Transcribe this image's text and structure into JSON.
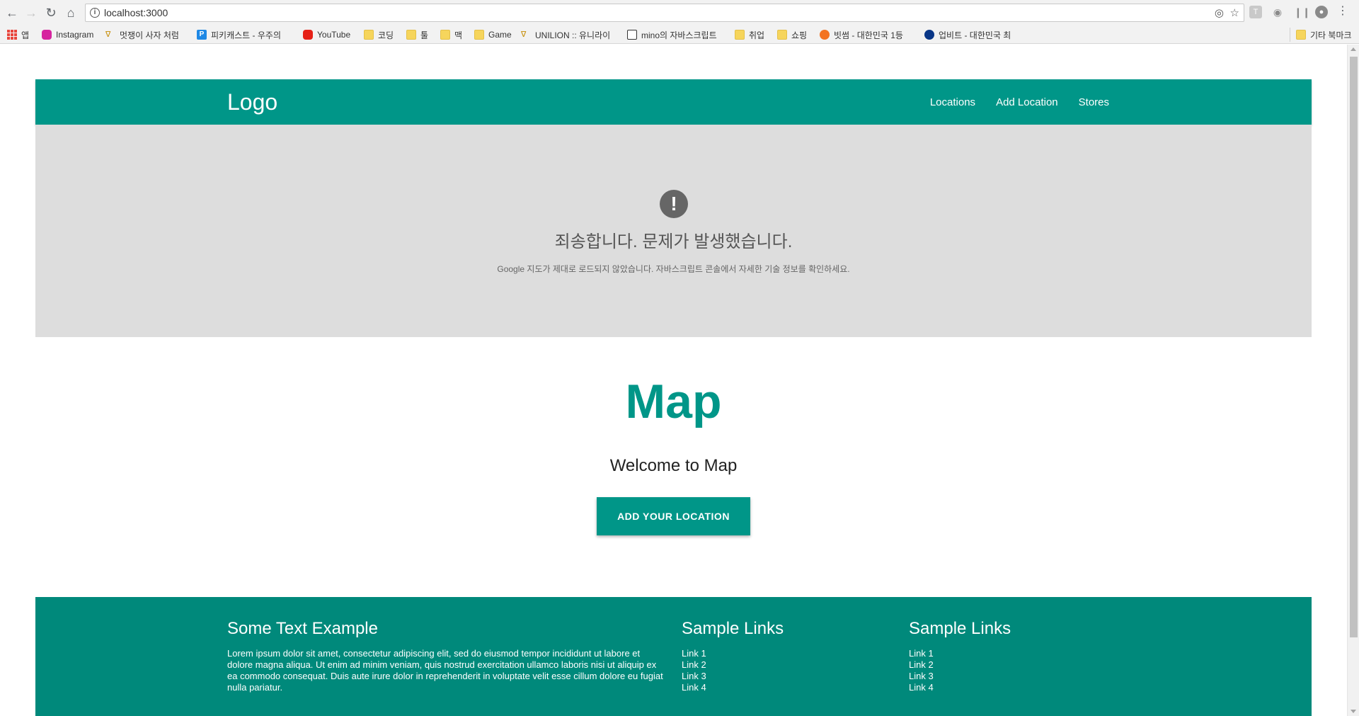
{
  "browser": {
    "url": "localhost:3000",
    "bookmarks": [
      {
        "label": "앱",
        "icon": "apps-grid-icon"
      },
      {
        "label": "Instagram",
        "icon": "instagram-icon"
      },
      {
        "label": "멋쟁이 사자 처럼",
        "icon": "lion-icon"
      },
      {
        "label": "피키캐스트 - 우주의",
        "icon": "pikicast-icon"
      },
      {
        "label": "YouTube",
        "icon": "youtube-icon"
      },
      {
        "label": "코딩",
        "icon": "folder-icon"
      },
      {
        "label": "툴",
        "icon": "folder-icon"
      },
      {
        "label": "맥",
        "icon": "folder-icon"
      },
      {
        "label": "Game",
        "icon": "folder-icon"
      },
      {
        "label": "UNILION :: 유니라이",
        "icon": "lion-icon"
      },
      {
        "label": "mino의 자바스크립트",
        "icon": "book-icon"
      },
      {
        "label": "취업",
        "icon": "folder-icon"
      },
      {
        "label": "쇼핑",
        "icon": "folder-icon"
      },
      {
        "label": "빗썸 - 대한민국 1등",
        "icon": "bithumb-icon"
      },
      {
        "label": "업비트 - 대한민국 최",
        "icon": "upbit-icon"
      }
    ],
    "other_bookmarks": "기타 북마크"
  },
  "navbar": {
    "logo": "Logo",
    "links": [
      "Locations",
      "Add Location",
      "Stores"
    ]
  },
  "map_error": {
    "icon": "!",
    "title": "죄송합니다. 문제가 발생했습니다.",
    "message": "Google 지도가 제대로 로드되지 않았습니다. 자바스크립트 콘솔에서 자세한 기술 정보를 확인하세요."
  },
  "hero": {
    "title": "Map",
    "subtitle": "Welcome to Map",
    "cta_label": "ADD YOUR LOCATION"
  },
  "footer": {
    "text_heading": "Some Text Example",
    "text_body": "Lorem ipsum dolor sit amet, consectetur adipiscing elit, sed do eiusmod tempor incididunt ut labore et dolore magna aliqua. Ut enim ad minim veniam, quis nostrud exercitation ullamco laboris nisi ut aliquip ex ea commodo consequat. Duis aute irure dolor in reprehenderit in voluptate velit esse cillum dolore eu fugiat nulla pariatur.",
    "links_heading_1": "Sample Links",
    "links_1": [
      "Link 1",
      "Link 2",
      "Link 3",
      "Link 4"
    ],
    "links_heading_2": "Sample Links",
    "links_2": [
      "Link 1",
      "Link 2",
      "Link 3",
      "Link 4"
    ]
  },
  "colors": {
    "primary": "#009688",
    "footer": "#00897b",
    "map_placeholder": "#dddddd"
  }
}
